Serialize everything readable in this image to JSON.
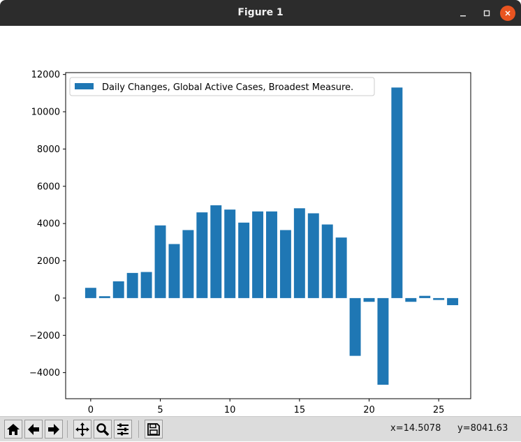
{
  "window": {
    "title": "Figure 1",
    "minimize_icon": "minimize-icon",
    "maximize_icon": "maximize-icon",
    "close_icon": "close-icon"
  },
  "toolbar": {
    "buttons": [
      {
        "name": "home-button",
        "icon": "home-icon"
      },
      {
        "name": "back-button",
        "icon": "arrow-left-icon"
      },
      {
        "name": "forward-button",
        "icon": "arrow-right-icon"
      },
      {
        "name": "pan-button",
        "icon": "move-icon"
      },
      {
        "name": "zoom-button",
        "icon": "magnifier-icon"
      },
      {
        "name": "configure-subplots-button",
        "icon": "sliders-icon"
      },
      {
        "name": "save-button",
        "icon": "floppy-disk-icon"
      }
    ],
    "x_readout": "x=14.5078",
    "y_readout": "y=8041.63"
  },
  "colors": {
    "bar": "#1f77b4",
    "titlebar": "#2c2c2c",
    "close_button": "#e95420",
    "toolbar": "#dcdcdc"
  },
  "chart_data": {
    "type": "bar",
    "x": [
      0,
      1,
      2,
      3,
      4,
      5,
      6,
      7,
      8,
      9,
      10,
      11,
      12,
      13,
      14,
      15,
      16,
      17,
      18,
      19,
      20,
      21,
      22,
      23,
      24,
      25,
      26
    ],
    "series": [
      {
        "name": "Daily Changes, Global Active Cases, Broadest Measure.",
        "values": [
          550,
          100,
          900,
          1350,
          1400,
          3900,
          2900,
          3650,
          4600,
          4980,
          4750,
          4050,
          4650,
          4650,
          3650,
          4820,
          4550,
          3950,
          3250,
          -3100,
          -200,
          -4650,
          11300,
          -200,
          120,
          -100,
          -380
        ]
      }
    ],
    "xlim": [
      -1.8,
      27.3
    ],
    "ylim": [
      -5400,
      12100
    ],
    "xticks": [
      0,
      5,
      10,
      15,
      20,
      25
    ],
    "xtick_labels": [
      "0",
      "5",
      "10",
      "15",
      "20",
      "25"
    ],
    "yticks": [
      -4000,
      -2000,
      0,
      2000,
      4000,
      6000,
      8000,
      10000,
      12000
    ],
    "ytick_labels": [
      "−4000",
      "−2000",
      "0",
      "2000",
      "4000",
      "6000",
      "8000",
      "10000",
      "12000"
    ],
    "legend_position": "upper left",
    "grid": false
  }
}
